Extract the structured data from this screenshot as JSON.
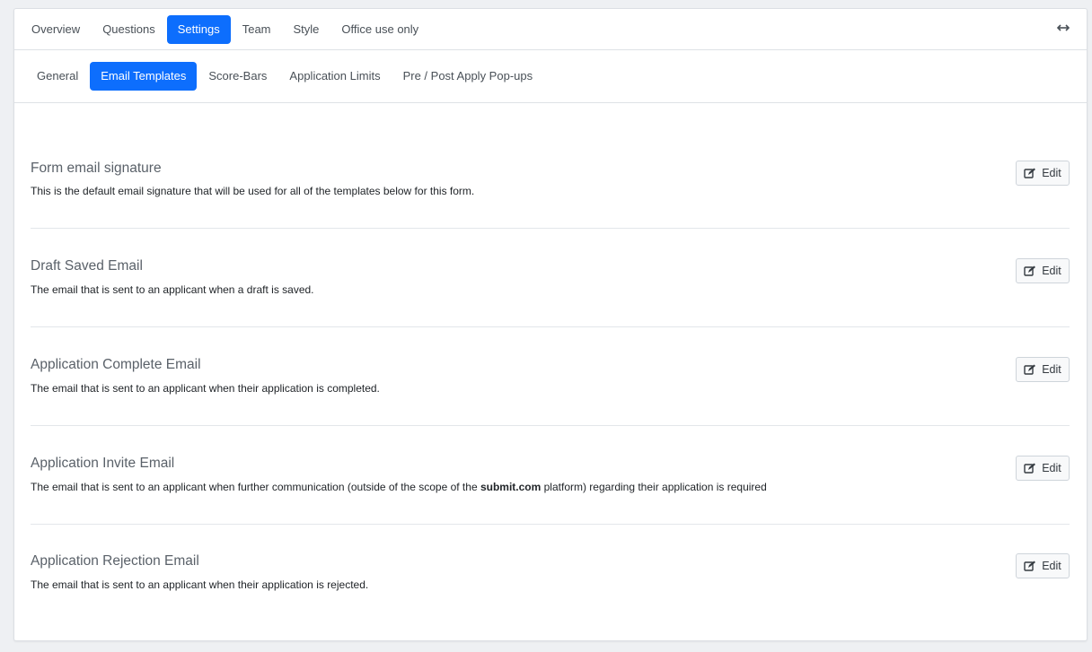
{
  "top_nav": {
    "tabs": [
      {
        "label": "Overview",
        "active": false
      },
      {
        "label": "Questions",
        "active": false
      },
      {
        "label": "Settings",
        "active": true
      },
      {
        "label": "Team",
        "active": false
      },
      {
        "label": "Style",
        "active": false
      },
      {
        "label": "Office use only",
        "active": false
      }
    ],
    "expand_icon": "expand-horizontal-icon"
  },
  "sub_nav": {
    "tabs": [
      {
        "label": "General",
        "active": false
      },
      {
        "label": "Email Templates",
        "active": true
      },
      {
        "label": "Score-Bars",
        "active": false
      },
      {
        "label": "Application Limits",
        "active": false
      },
      {
        "label": "Pre / Post Apply Pop-ups",
        "active": false
      }
    ]
  },
  "templates": [
    {
      "title": "Form email signature",
      "description": "This is the default email signature that will be used for all of the templates below for this form.",
      "edit_label": "Edit"
    },
    {
      "title": "Draft Saved Email",
      "description": "The email that is sent to an applicant when a draft is saved.",
      "edit_label": "Edit"
    },
    {
      "title": "Application Complete Email",
      "description": "The email that is sent to an applicant when their application is completed.",
      "edit_label": "Edit"
    },
    {
      "title": "Application Invite Email",
      "description_pre": "The email that is sent to an applicant when further communication (outside of the scope of the ",
      "description_bold": "submit.com",
      "description_post": " platform) regarding their application is required",
      "edit_label": "Edit"
    },
    {
      "title": "Application Rejection Email",
      "description": "The email that is sent to an applicant when their application is rejected.",
      "edit_label": "Edit"
    }
  ],
  "colors": {
    "accent": "#0d6efd",
    "background": "#eef0f3",
    "card": "#ffffff"
  }
}
